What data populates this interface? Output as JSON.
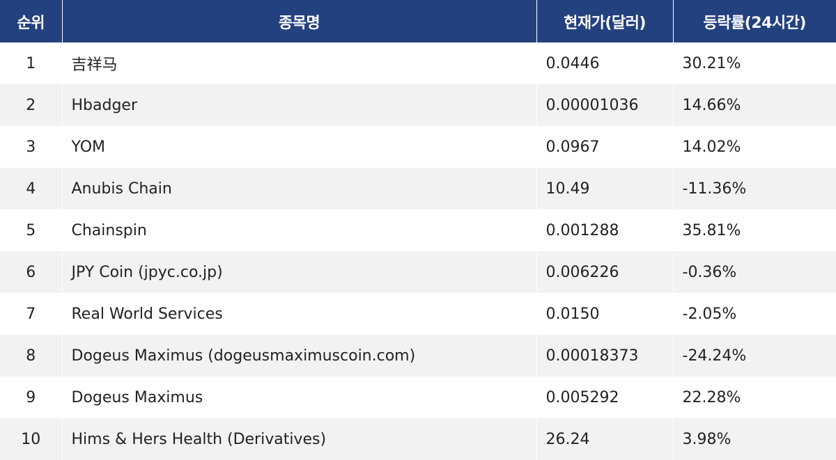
{
  "table": {
    "headers": {
      "rank": "순위",
      "name": "종목명",
      "price": "현재가(달러)",
      "change": "등락률(24시간)"
    },
    "rows": [
      {
        "rank": "1",
        "name": "吉祥马",
        "price": "0.0446",
        "change": "30.21%"
      },
      {
        "rank": "2",
        "name": "Hbadger",
        "price": "0.00001036",
        "change": "14.66%"
      },
      {
        "rank": "3",
        "name": "YOM",
        "price": "0.0967",
        "change": "14.02%"
      },
      {
        "rank": "4",
        "name": "Anubis Chain",
        "price": "10.49",
        "change": "-11.36%"
      },
      {
        "rank": "5",
        "name": "Chainspin",
        "price": "0.001288",
        "change": "35.81%"
      },
      {
        "rank": "6",
        "name": "JPY Coin (jpyc.co.jp)",
        "price": "0.006226",
        "change": "-0.36%"
      },
      {
        "rank": "7",
        "name": "Real World Services",
        "price": "0.0150",
        "change": "-2.05%"
      },
      {
        "rank": "8",
        "name": "Dogeus Maximus (dogeusmaximuscoin.com)",
        "price": "0.00018373",
        "change": "-24.24%"
      },
      {
        "rank": "9",
        "name": "Dogeus Maximus",
        "price": "0.005292",
        "change": "22.28%"
      },
      {
        "rank": "10",
        "name": "Hims & Hers Health (Derivatives)",
        "price": "26.24",
        "change": "3.98%"
      }
    ]
  },
  "colors": {
    "header_bg": "#24417f",
    "header_text": "#ffffff",
    "row_alt_bg": "#f2f2f2",
    "body_text": "#222222"
  }
}
